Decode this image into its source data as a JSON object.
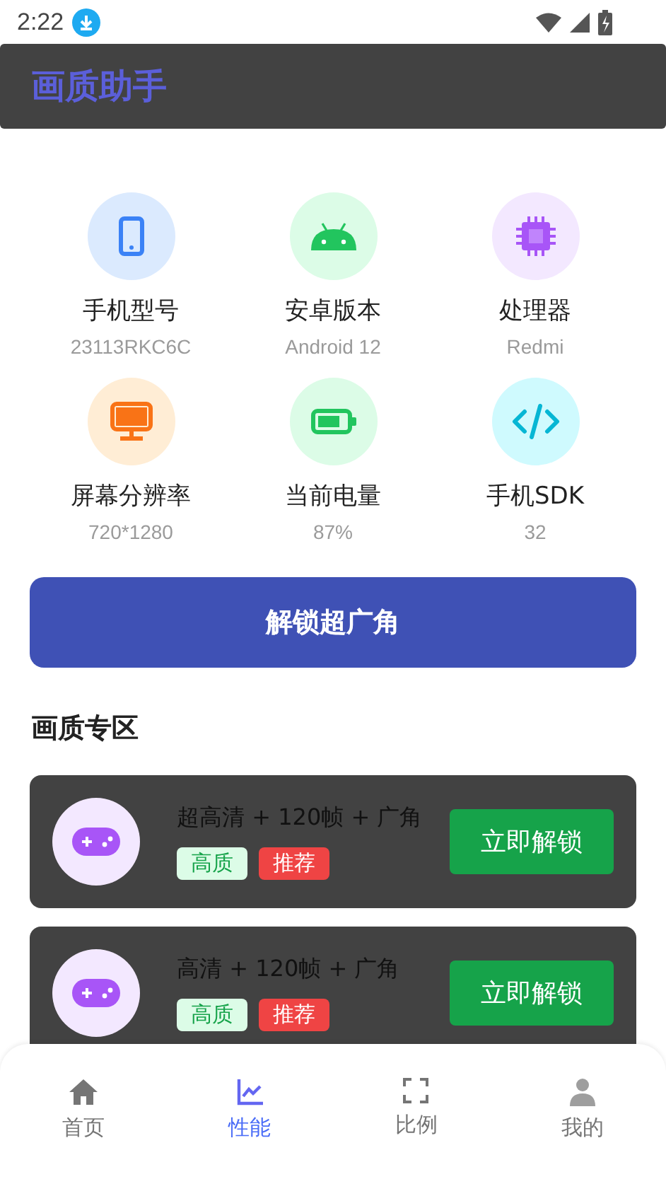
{
  "status_bar": {
    "time": "2:22"
  },
  "app_bar": {
    "title": "画质助手"
  },
  "device_info": [
    {
      "kind": "phone",
      "label": "手机型号",
      "value": "23113RKC6C"
    },
    {
      "kind": "android",
      "label": "安卓版本",
      "value": "Android 12"
    },
    {
      "kind": "chip",
      "label": "处理器",
      "value": "Redmi"
    },
    {
      "kind": "monitor",
      "label": "屏幕分辨率",
      "value": "720*1280"
    },
    {
      "kind": "battery",
      "label": "当前电量",
      "value": "87%"
    },
    {
      "kind": "code",
      "label": "手机SDK",
      "value": "32"
    }
  ],
  "unlock_button": "解锁超广角",
  "section_title": "画质专区",
  "presets": [
    {
      "title": "超高清 + 120帧 + 广角",
      "tags": [
        {
          "kind": "quality",
          "text": "高质"
        },
        {
          "kind": "recommend",
          "text": "推荐"
        }
      ],
      "button": "立即解锁"
    },
    {
      "title": "高清 + 120帧 + 广角",
      "tags": [
        {
          "kind": "quality",
          "text": "高质"
        },
        {
          "kind": "recommend",
          "text": "推荐"
        }
      ],
      "button": "立即解锁"
    }
  ],
  "bottom_nav": [
    {
      "kind": "home",
      "label": "首页",
      "selected": false
    },
    {
      "kind": "chart",
      "label": "性能",
      "selected": true
    },
    {
      "kind": "ratio",
      "label": "比例",
      "selected": false
    },
    {
      "kind": "person",
      "label": "我的",
      "selected": false
    }
  ]
}
